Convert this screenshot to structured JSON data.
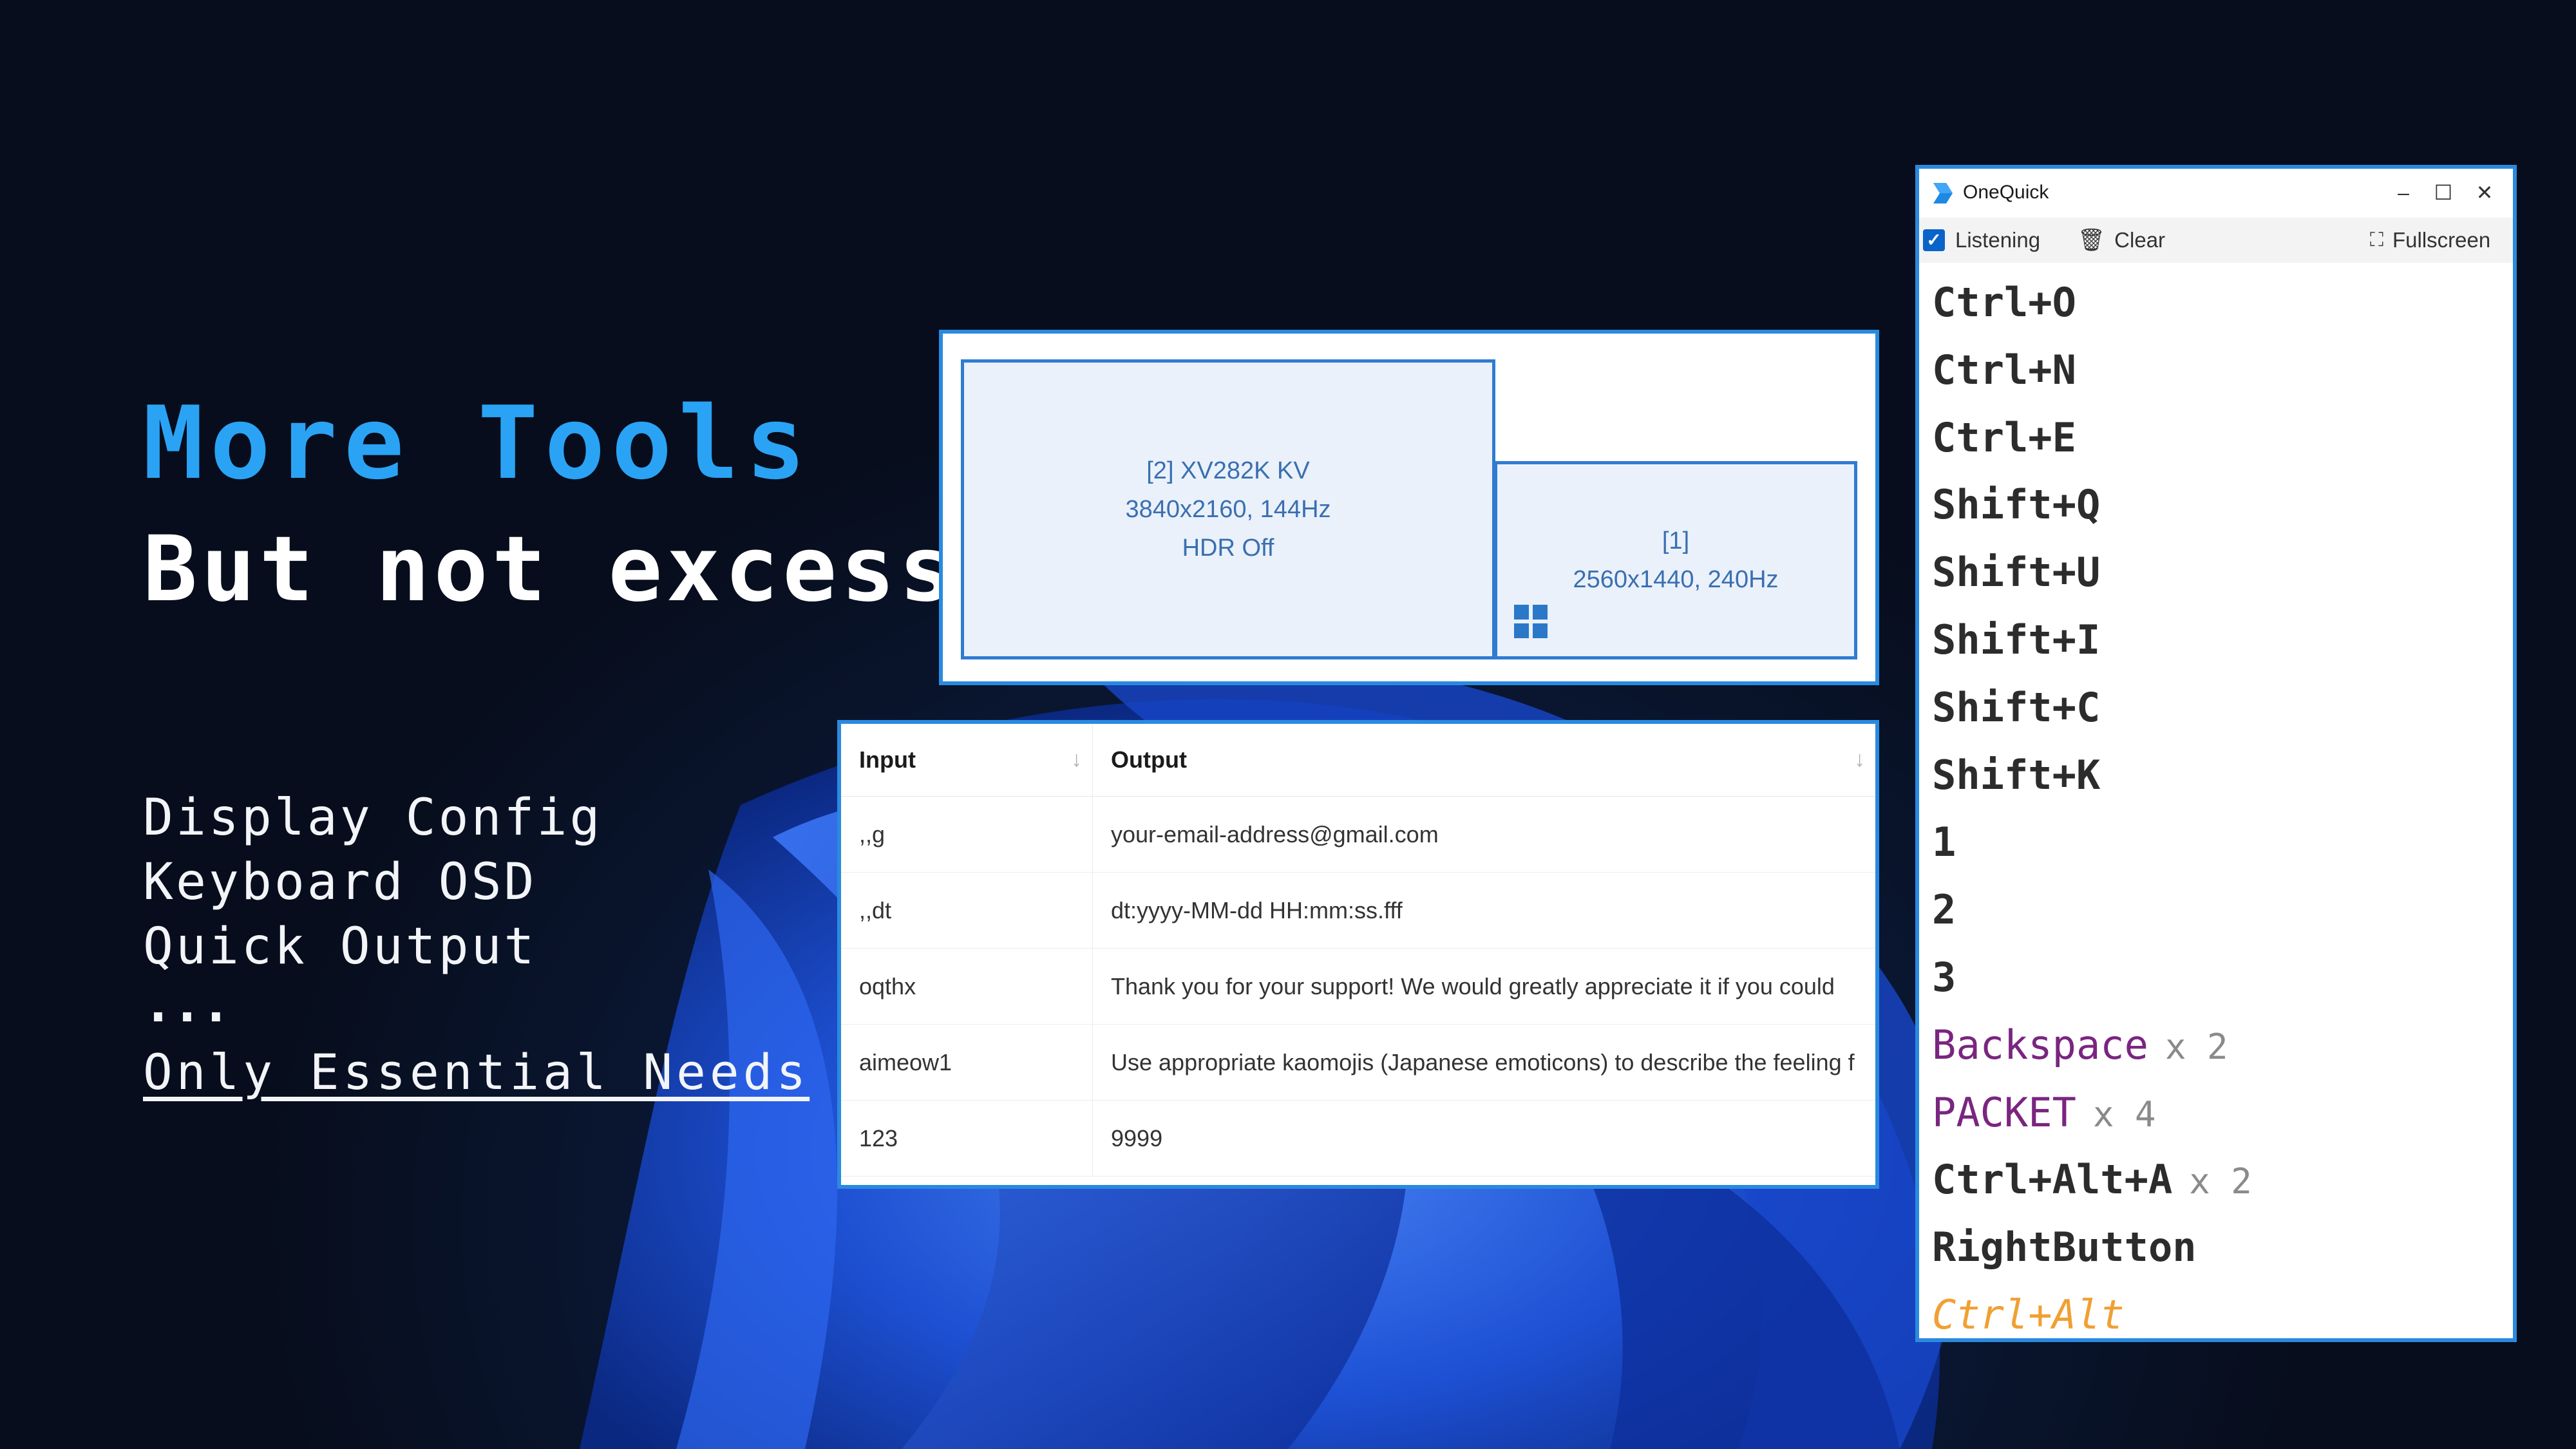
{
  "hero": {
    "title": "More Tools",
    "subtitle": "But not excess",
    "features": [
      "Display Config",
      "Keyboard OSD",
      "Quick Output",
      "..."
    ],
    "tagline": "Only Essential Needs"
  },
  "display_config": {
    "monitors": [
      {
        "id_label": "[2] XV282K KV",
        "resolution": "3840x2160, 144Hz",
        "hdr": "HDR Off"
      },
      {
        "id_label": "[1]",
        "resolution": "2560x1440, 240Hz"
      }
    ]
  },
  "quick_output": {
    "columns": [
      "Input",
      "Output"
    ],
    "rows": [
      [
        ",,g",
        "your-email-address@gmail.com"
      ],
      [
        ",,dt",
        "dt:yyyy-MM-dd HH:mm:ss.fff"
      ],
      [
        "oqthx",
        "Thank you for your support! We would greatly appreciate it if you could"
      ],
      [
        "aimeow1",
        "Use appropriate kaomojis (Japanese emoticons) to describe the feeling f"
      ],
      [
        "123",
        "9999"
      ]
    ]
  },
  "onequick": {
    "title": "OneQuick",
    "listening_label": "Listening",
    "listening_checked": true,
    "clear_label": "Clear",
    "fullscreen_label": "Fullscreen",
    "keys": [
      {
        "key": "Ctrl+O",
        "count": ""
      },
      {
        "key": "Ctrl+N",
        "count": ""
      },
      {
        "key": "Ctrl+E",
        "count": ""
      },
      {
        "key": "Shift+Q",
        "count": ""
      },
      {
        "key": "Shift+U",
        "count": ""
      },
      {
        "key": "Shift+I",
        "count": ""
      },
      {
        "key": "Shift+C",
        "count": ""
      },
      {
        "key": "Shift+K",
        "count": ""
      },
      {
        "key": "1",
        "count": ""
      },
      {
        "key": "2",
        "count": ""
      },
      {
        "key": "3",
        "count": ""
      },
      {
        "key": "Backspace",
        "count": "x 2"
      },
      {
        "key": "PACKET",
        "count": "x 4"
      },
      {
        "key": "Ctrl+Alt+A",
        "count": "x 2"
      },
      {
        "key": "RightButton",
        "count": ""
      },
      {
        "key": "Ctrl+Alt",
        "count": ""
      }
    ]
  },
  "colors": {
    "accent": "#2aa3f5",
    "panel_border": "#2a8ae0",
    "key_purple": "#7a2580",
    "key_orange": "#f0a033"
  }
}
